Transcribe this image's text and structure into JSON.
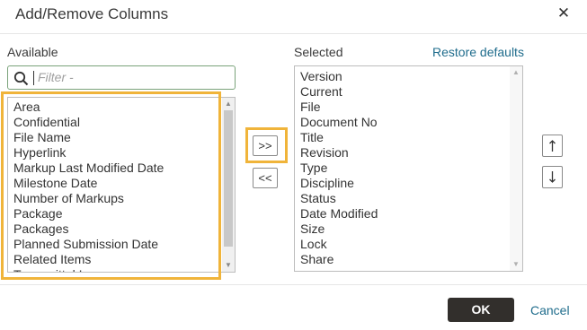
{
  "dialog": {
    "title": "Add/Remove Columns",
    "close_icon": "close-icon"
  },
  "available": {
    "label": "Available",
    "filter_placeholder": "Filter -",
    "items": [
      "Area",
      "Confidential",
      "File Name",
      "Hyperlink",
      "Markup Last Modified Date",
      "Milestone Date",
      "Number of Markups",
      "Package",
      "Packages",
      "Planned Submission Date",
      "Related Items",
      "Transmittal In"
    ]
  },
  "selected": {
    "label": "Selected",
    "restore_label": "Restore defaults",
    "items": [
      "Version",
      "Current",
      "File",
      "Document No",
      "Title",
      "Revision",
      "Type",
      "Discipline",
      "Status",
      "Date Modified",
      "Size",
      "Lock",
      "Share"
    ]
  },
  "transfer": {
    "add_label": ">>",
    "remove_label": "<<"
  },
  "order": {
    "up_icon": "arrow-up-icon",
    "down_icon": "arrow-down-icon"
  },
  "footer": {
    "ok_label": "OK",
    "cancel_label": "Cancel"
  },
  "colors": {
    "highlight": "#f0b43a",
    "link": "#1f6c8c",
    "primary_button": "#322f2c"
  }
}
